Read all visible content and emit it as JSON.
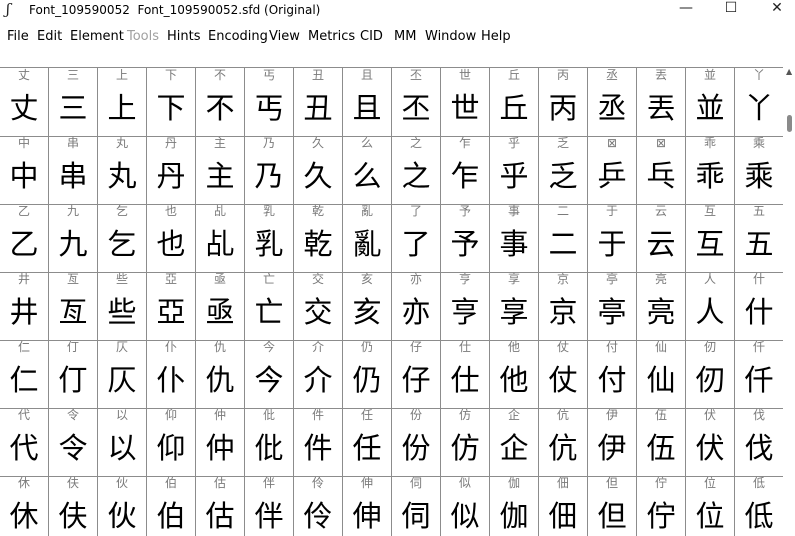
{
  "window": {
    "title": "Font_109590052  Font_109590052.sfd (Original)",
    "app_icon": "fontforge-icon",
    "minimize": "—",
    "maximize": "☐",
    "close": "✕"
  },
  "menu": {
    "items": [
      {
        "label": "File",
        "enabled": true
      },
      {
        "label": "Edit",
        "enabled": true
      },
      {
        "label": "Element",
        "enabled": true
      },
      {
        "label": "Tools",
        "enabled": false
      },
      {
        "label": "Hints",
        "enabled": true
      },
      {
        "label": "Encoding",
        "enabled": true
      },
      {
        "label": "View",
        "enabled": true
      },
      {
        "label": "Metrics",
        "enabled": true
      },
      {
        "label": "CID",
        "enabled": true
      },
      {
        "label": "MM",
        "enabled": true
      },
      {
        "label": "Window",
        "enabled": true
      },
      {
        "label": "Help",
        "enabled": true
      }
    ]
  },
  "grid": {
    "rows": [
      {
        "labels": [
          "丈",
          "三",
          "上",
          "下",
          "不",
          "丐",
          "丑",
          "且",
          "丕",
          "世",
          "丘",
          "丙",
          "丞",
          "丟",
          "並",
          "丫"
        ],
        "glyphs": [
          "丈",
          "三",
          "上",
          "下",
          "不",
          "丐",
          "丑",
          "且",
          "丕",
          "世",
          "丘",
          "丙",
          "丞",
          "丟",
          "並",
          "丫"
        ]
      },
      {
        "labels": [
          "中",
          "串",
          "丸",
          "丹",
          "主",
          "乃",
          "久",
          "么",
          "之",
          "乍",
          "乎",
          "乏",
          "⊠",
          "⊠",
          "乖",
          "乘"
        ],
        "glyphs": [
          "中",
          "串",
          "丸",
          "丹",
          "主",
          "乃",
          "久",
          "么",
          "之",
          "乍",
          "乎",
          "乏",
          "乒",
          "乓",
          "乖",
          "乘"
        ]
      },
      {
        "labels": [
          "乙",
          "九",
          "乞",
          "也",
          "乩",
          "乳",
          "乾",
          "亂",
          "了",
          "予",
          "事",
          "二",
          "于",
          "云",
          "互",
          "五"
        ],
        "glyphs": [
          "乙",
          "九",
          "乞",
          "也",
          "乩",
          "乳",
          "乾",
          "亂",
          "了",
          "予",
          "事",
          "二",
          "于",
          "云",
          "互",
          "五"
        ]
      },
      {
        "labels": [
          "井",
          "亙",
          "些",
          "亞",
          "亟",
          "亡",
          "交",
          "亥",
          "亦",
          "亨",
          "享",
          "京",
          "亭",
          "亮",
          "人",
          "什"
        ],
        "glyphs": [
          "井",
          "亙",
          "些",
          "亞",
          "亟",
          "亡",
          "交",
          "亥",
          "亦",
          "亨",
          "享",
          "京",
          "亭",
          "亮",
          "人",
          "什"
        ]
      },
      {
        "labels": [
          "仁",
          "仃",
          "仄",
          "仆",
          "仇",
          "今",
          "介",
          "仍",
          "仔",
          "仕",
          "他",
          "仗",
          "付",
          "仙",
          "仞",
          "仟"
        ],
        "glyphs": [
          "仁",
          "仃",
          "仄",
          "仆",
          "仇",
          "今",
          "介",
          "仍",
          "仔",
          "仕",
          "他",
          "仗",
          "付",
          "仙",
          "仞",
          "仟"
        ]
      },
      {
        "labels": [
          "代",
          "令",
          "以",
          "仰",
          "仲",
          "仳",
          "件",
          "任",
          "份",
          "仿",
          "企",
          "伉",
          "伊",
          "伍",
          "伏",
          "伐"
        ],
        "glyphs": [
          "代",
          "令",
          "以",
          "仰",
          "仲",
          "仳",
          "件",
          "任",
          "份",
          "仿",
          "企",
          "伉",
          "伊",
          "伍",
          "伏",
          "伐"
        ]
      },
      {
        "labels": [
          "休",
          "伕",
          "伙",
          "伯",
          "估",
          "伴",
          "伶",
          "伸",
          "伺",
          "似",
          "伽",
          "佃",
          "但",
          "佇",
          "位",
          "低"
        ],
        "glyphs": [
          "休",
          "伕",
          "伙",
          "伯",
          "估",
          "伴",
          "伶",
          "伸",
          "伺",
          "似",
          "伽",
          "佃",
          "但",
          "佇",
          "位",
          "低"
        ]
      }
    ]
  }
}
